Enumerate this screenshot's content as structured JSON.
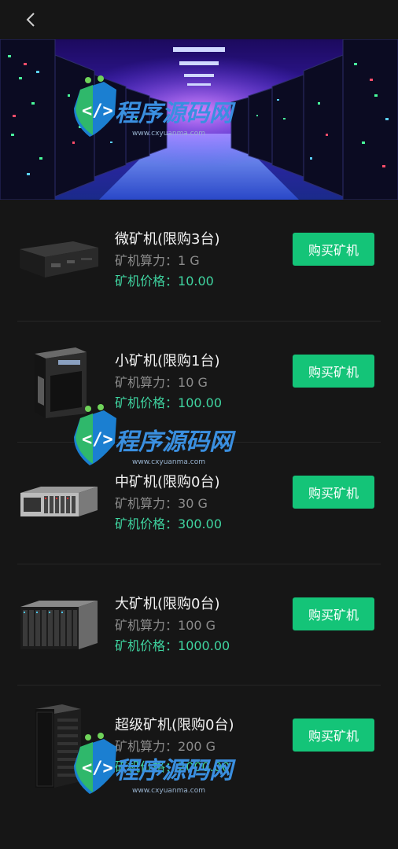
{
  "header": {
    "back_icon": "chevron-left-icon"
  },
  "banner": {
    "image": "server-room-corridor"
  },
  "watermark": {
    "title": "程序源码网",
    "url": "www.cxyuanma.com"
  },
  "miners": [
    {
      "name": "微矿机(限购3台)",
      "power_label": "矿机算力：",
      "power": "1 G",
      "price_label": "矿机价格：",
      "price": "10.00",
      "button": "购买矿机",
      "image": "small-box-server"
    },
    {
      "name": "小矿机(限购1台)",
      "power_label": "矿机算力：",
      "power": "10 G",
      "price_label": "矿机价格：",
      "price": "100.00",
      "button": "购买矿机",
      "image": "tower-server"
    },
    {
      "name": "中矿机(限购0台)",
      "power_label": "矿机算力：",
      "power": "30 G",
      "price_label": "矿机价格：",
      "price": "300.00",
      "button": "购买矿机",
      "image": "rack-server"
    },
    {
      "name": "大矿机(限购0台)",
      "power_label": "矿机算力：",
      "power": "100 G",
      "price_label": "矿机价格：",
      "price": "1000.00",
      "button": "购买矿机",
      "image": "blade-server"
    },
    {
      "name": "超级矿机(限购0台)",
      "power_label": "矿机算力：",
      "power": "200 G",
      "price_label": "矿机价格：",
      "price": "2000.00",
      "button": "购买矿机",
      "image": "server-cabinet"
    }
  ],
  "colors": {
    "background": "#161616",
    "accent": "#14c478",
    "price": "#3fd4a0"
  }
}
